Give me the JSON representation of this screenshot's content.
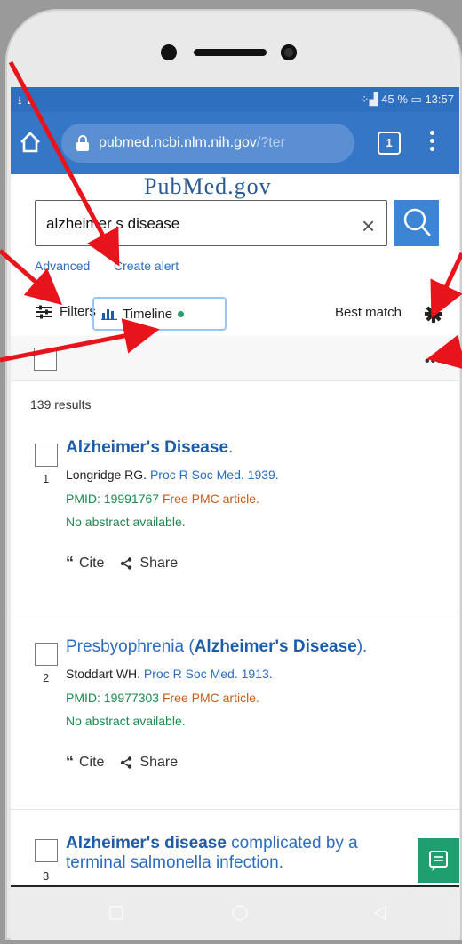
{
  "status_bar": {
    "left_icons": "⭳ ▲",
    "right_text": "45 %",
    "time": "13:57"
  },
  "browser": {
    "url_main": "pubmed.ncbi.nlm.nih.gov",
    "url_rest": "/?ter",
    "tab_count": "1"
  },
  "logo": "PubMed.gov",
  "search": {
    "query": "alzheimer s disease",
    "clear_glyph": "×"
  },
  "links": {
    "advanced": "Advanced",
    "create_alert": "Create alert"
  },
  "controls": {
    "filters": "Filters",
    "timeline": "Timeline",
    "sort": "Best match",
    "more": "•••"
  },
  "results_count": "139 results",
  "results": [
    {
      "num": "1",
      "title_bold": "Alzheimer's Disease",
      "title_rest": ".",
      "authors": "Longridge RG.",
      "journal": "Proc R Soc Med. 1939.",
      "pmid": "PMID: 19991767",
      "free": "Free PMC article.",
      "abstract": "No abstract available.",
      "cite": "Cite",
      "share": "Share"
    },
    {
      "num": "2",
      "title_pre": "Presbyophrenia (",
      "title_bold": "Alzheimer's Disease",
      "title_rest": ").",
      "authors": "Stoddart WH.",
      "journal": "Proc R Soc Med. 1913.",
      "pmid": "PMID: 19977303",
      "free": "Free PMC article.",
      "abstract": "No abstract available.",
      "cite": "Cite",
      "share": "Share"
    },
    {
      "num": "3",
      "title_bold": "Alzheimer's disease",
      "title_rest": " complicated by a",
      "title_line2": "terminal salmonella infection."
    }
  ],
  "colors": {
    "browser_bar": "#3676c6",
    "link_blue": "#2b6cc1",
    "pmid_green": "#1a8a4e",
    "free_orange": "#c65d1a",
    "annotation_arrow": "#e8141c"
  }
}
